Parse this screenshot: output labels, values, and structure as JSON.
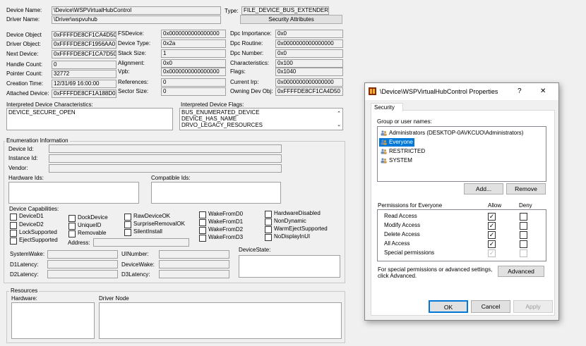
{
  "top": {
    "device_name_label": "Device Name:",
    "device_name": "\\Device\\WSPVirtualHubControl",
    "driver_name_label": "Driver Name:",
    "driver_name": "\\Driver\\wspvuhub",
    "type_label": "Type:",
    "type_value": "FILE_DEVICE_BUS_EXTENDER",
    "security_button": "Security Attributes"
  },
  "col1": [
    {
      "label": "Device Object",
      "value": "0xFFFFDE8CF1CA4D50"
    },
    {
      "label": "Driver Object:",
      "value": "0xFFFFDE8CF1956AA0"
    },
    {
      "label": "Next Device:",
      "value": "0xFFFFDE8CF1CA7D50"
    },
    {
      "label": "Handle Count:",
      "value": "0"
    },
    {
      "label": "Pointer Count:",
      "value": "32772"
    },
    {
      "label": "Creation Time:",
      "value": "12/31/69 16:00:00"
    },
    {
      "label": "Attached Device:",
      "value": "0xFFFFDE8CF1A188D0"
    }
  ],
  "col2": [
    {
      "label": "FSDevice:",
      "value": "0x0000000000000000"
    },
    {
      "label": "Device Type:",
      "value": "0x2a"
    },
    {
      "label": "Stack Size:",
      "value": "1"
    },
    {
      "label": "Alignment:",
      "value": "0x0"
    },
    {
      "label": "Vpb:",
      "value": "0x0000000000000000"
    },
    {
      "label": "References:",
      "value": "0"
    },
    {
      "label": "Sector Size:",
      "value": "0"
    }
  ],
  "col3": [
    {
      "label": "Dpc Importance:",
      "value": "0x0"
    },
    {
      "label": "Dpc Routine:",
      "value": "0x0000000000000000"
    },
    {
      "label": "Dpc Number:",
      "value": "0x0"
    },
    {
      "label": "Characteristics:",
      "value": "0x100"
    },
    {
      "label": "Flags:",
      "value": "0x1040"
    },
    {
      "label": "Current Irp:",
      "value": "0x0000000000000000"
    },
    {
      "label": "Owning Dev Obj:",
      "value": "0xFFFFDE8CF1CA4D50"
    }
  ],
  "characteristics": {
    "label": "Interpreted Device Characteristics:",
    "lines": [
      "DEVICE_SECURE_OPEN"
    ]
  },
  "flags": {
    "label": "Interpreted Device Flags:",
    "lines": [
      "BUS_ENUMERATED_DEVICE",
      "DEVICE_HAS_NAME",
      "DRVO_LEGACY_RESOURCES"
    ]
  },
  "enumeration": {
    "title": "Enumeration Information",
    "device_id_label": "Device Id:",
    "instance_id_label": "Instance Id:",
    "vendor_label": "Vendor:",
    "hardware_ids_label": "Hardware Ids:",
    "compatible_ids_label": "Compatible Ids:",
    "capabilities_label": "Device Capabilities:",
    "caps_col1": [
      "DeviceD1",
      "DeviceD2",
      "LockSupported",
      "EjectSupported"
    ],
    "caps_col2": [
      "DockDevice",
      "UniqueID",
      "Removable"
    ],
    "address_label": "Address:",
    "caps_col3": [
      "RawDeviceOK",
      "SurpriseRemovalOK",
      "SilentInstall"
    ],
    "caps_col4": [
      "WakeFromD0",
      "WakeFromD1",
      "WakeFromD2",
      "WakeFromD3"
    ],
    "caps_col5": [
      "HardwareDisabled",
      "NonDynamic",
      "WarmEjectSupported",
      "NoDisplayInUI"
    ],
    "system_wake_label": "SystemWake:",
    "d1_latency_label": "D1Latency:",
    "d2_latency_label": "D2Latency:",
    "ui_number_label": "UINumber:",
    "device_wake_label": "DeviceWake:",
    "d3_latency_label": "D3Latency:",
    "device_state_label": "DeviceState:"
  },
  "resources": {
    "title": "Resources",
    "hardware_label": "Hardware:",
    "driver_node_label": "Driver Node"
  },
  "dialog": {
    "title": "\\Device\\WSPVirtualHubControl Properties",
    "help": "?",
    "close": "✕",
    "tab": "Security",
    "group_label": "Group or user names:",
    "users": [
      "Administrators (DESKTOP-0AVKCUO\\Administrators)",
      "Everyone",
      "RESTRICTED",
      "SYSTEM"
    ],
    "selected_user_index": 1,
    "add_button": "Add...",
    "remove_button": "Remove",
    "permissions_for": "Permissions for Everyone",
    "allow_label": "Allow",
    "deny_label": "Deny",
    "permissions": [
      {
        "name": "Read Access",
        "allow": true,
        "deny": false
      },
      {
        "name": "Modify Access",
        "allow": true,
        "deny": false
      },
      {
        "name": "Delete Access",
        "allow": true,
        "deny": false
      },
      {
        "name": "All Access",
        "allow": true,
        "deny": false
      },
      {
        "name": "Special permissions",
        "allow": true,
        "deny": false,
        "disabled": true
      }
    ],
    "special_text_1": "For special permissions or advanced settings,",
    "special_text_2": "click Advanced.",
    "advanced_button": "Advanced",
    "ok_button": "OK",
    "cancel_button": "Cancel",
    "apply_button": "Apply"
  },
  "colors": {
    "selection": "#0078d7",
    "window_bg": "#f0f0f0"
  }
}
